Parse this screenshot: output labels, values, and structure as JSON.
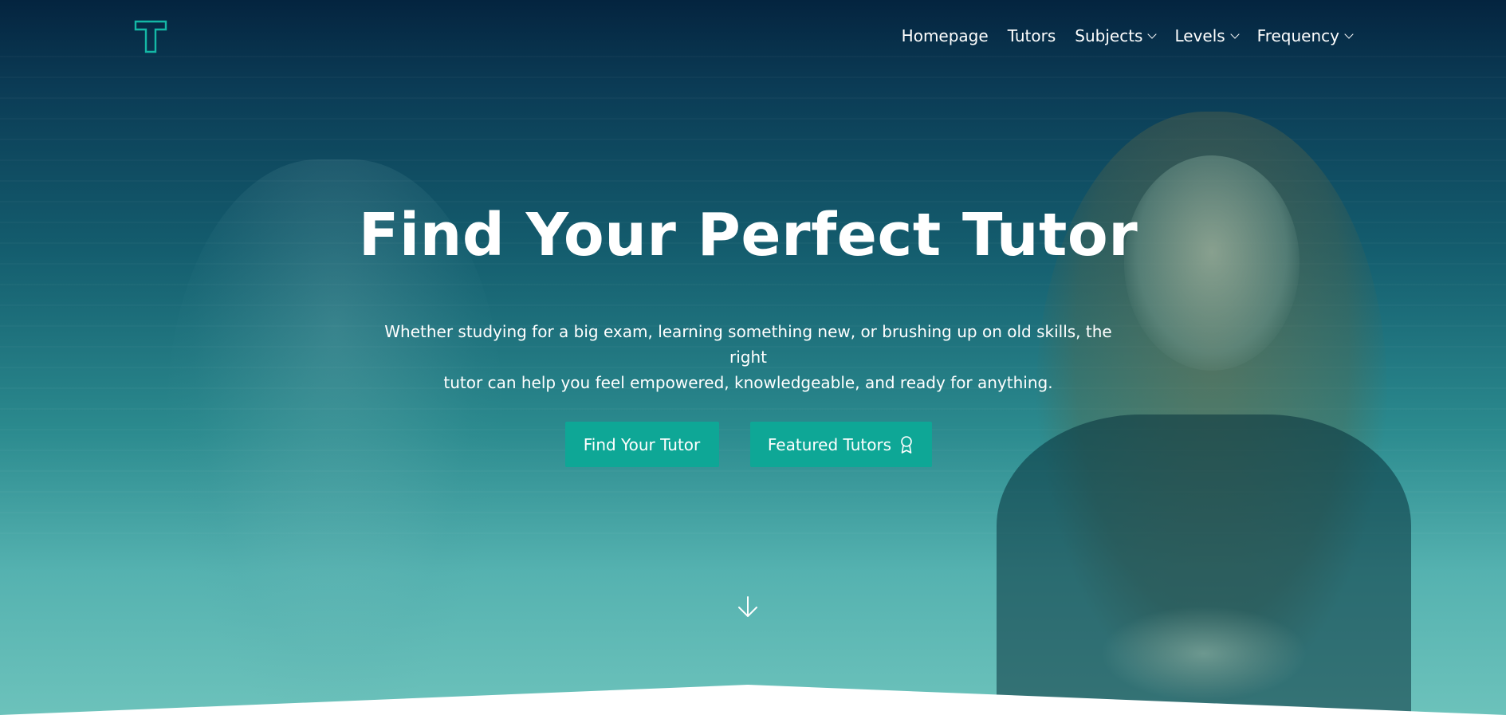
{
  "nav": {
    "logo_icon": "t-letter-logo",
    "items": [
      {
        "label": "Homepage",
        "dropdown": false
      },
      {
        "label": "Tutors",
        "dropdown": false
      },
      {
        "label": "Subjects",
        "dropdown": true
      },
      {
        "label": "Levels",
        "dropdown": true
      },
      {
        "label": "Frequency",
        "dropdown": true
      }
    ]
  },
  "hero": {
    "title": "Find Your Perfect Tutor",
    "subtitle_line1": "Whether studying for a big exam, learning something new, or brushing up on old skills, the right",
    "subtitle_line2": "tutor can help you feel empowered, knowledgeable, and ready for anything.",
    "primary_button": "Find Your Tutor",
    "secondary_button": "Featured Tutors",
    "secondary_button_icon": "award-ribbon-icon",
    "scroll_icon": "arrow-down-icon"
  },
  "colors": {
    "accent": "#0ea796",
    "logo": "#14b8a6",
    "text": "#ffffff",
    "bg_top": "#04243f",
    "bg_bottom": "#6cc2bb"
  }
}
